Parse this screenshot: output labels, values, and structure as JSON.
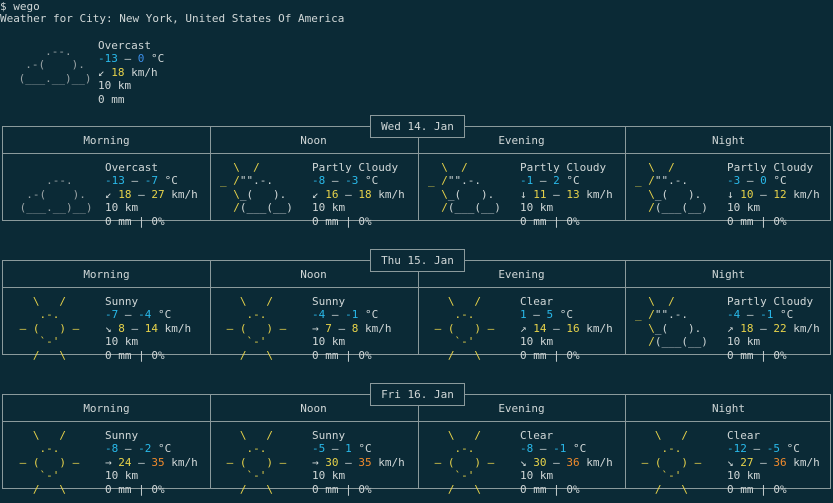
{
  "terminal": {
    "prompt": "$ wego",
    "header": "Weather for City: New York, United States Of America"
  },
  "current": {
    "art": [
      "     .--.    ",
      "  .-(    ).  ",
      " (___.__)__) "
    ],
    "art_color": "#9aa3a5",
    "condition": "Overcast",
    "temp_low": "-13",
    "temp_high": "0",
    "temp_unit": "°C",
    "wind_arrow": "↙",
    "wind_low": "18",
    "wind_high": "",
    "wind_unit": "km/h",
    "visibility": "10 km",
    "precip": "0 mm",
    "chance": ""
  },
  "segments": [
    "Morning",
    "Noon",
    "Evening",
    "Night"
  ],
  "days": [
    {
      "date": "Wed 14. Jan",
      "slots": [
        {
          "art_type": "cloud",
          "condition": "Overcast",
          "temp_low": "-13",
          "temp_high": "-7",
          "wind_arrow": "↙",
          "wind_low": "18",
          "wind_high": "27",
          "visibility": "10 km",
          "precip": "0 mm | 0%"
        },
        {
          "art_type": "partly",
          "condition": "Partly Cloudy",
          "temp_low": "-8",
          "temp_high": "-3",
          "wind_arrow": "↙",
          "wind_low": "16",
          "wind_high": "18",
          "visibility": "10 km",
          "precip": "0 mm | 0%"
        },
        {
          "art_type": "partly",
          "condition": "Partly Cloudy",
          "temp_low": "-1",
          "temp_high": "2",
          "wind_arrow": "↓",
          "wind_low": "11",
          "wind_high": "13",
          "visibility": "10 km",
          "precip": "0 mm | 0%"
        },
        {
          "art_type": "partly",
          "condition": "Partly Cloudy",
          "temp_low": "-3",
          "temp_high": "0",
          "wind_arrow": "↓",
          "wind_low": "10",
          "wind_high": "12",
          "visibility": "10 km",
          "precip": "0 mm | 0%"
        }
      ]
    },
    {
      "date": "Thu 15. Jan",
      "slots": [
        {
          "art_type": "sun",
          "condition": "Sunny",
          "temp_low": "-7",
          "temp_high": "-4",
          "wind_arrow": "↘",
          "wind_low": "8",
          "wind_high": "14",
          "visibility": "10 km",
          "precip": "0 mm | 0%"
        },
        {
          "art_type": "sun",
          "condition": "Sunny",
          "temp_low": "-4",
          "temp_high": "-1",
          "wind_arrow": "→",
          "wind_low": "7",
          "wind_high": "8",
          "visibility": "10 km",
          "precip": "0 mm | 0%"
        },
        {
          "art_type": "sun",
          "condition": "Clear",
          "temp_low": "1",
          "temp_high": "5",
          "wind_arrow": "↗",
          "wind_low": "14",
          "wind_high": "16",
          "visibility": "10 km",
          "precip": "0 mm | 0%"
        },
        {
          "art_type": "partly",
          "condition": "Partly Cloudy",
          "temp_low": "-4",
          "temp_high": "-1",
          "wind_arrow": "↗",
          "wind_low": "18",
          "wind_high": "22",
          "visibility": "10 km",
          "precip": "0 mm | 0%"
        }
      ]
    },
    {
      "date": "Fri 16. Jan",
      "slots": [
        {
          "art_type": "sun",
          "condition": "Sunny",
          "temp_low": "-8",
          "temp_high": "-2",
          "wind_arrow": "→",
          "wind_low": "24",
          "wind_high": "35",
          "visibility": "10 km",
          "precip": "0 mm | 0%"
        },
        {
          "art_type": "sun",
          "condition": "Sunny",
          "temp_low": "-5",
          "temp_high": "1",
          "wind_arrow": "→",
          "wind_low": "30",
          "wind_high": "35",
          "visibility": "10 km",
          "precip": "0 mm | 0%"
        },
        {
          "art_type": "sun",
          "condition": "Clear",
          "temp_low": "-8",
          "temp_high": "-1",
          "wind_arrow": "↘",
          "wind_low": "30",
          "wind_high": "36",
          "visibility": "10 km",
          "precip": "0 mm | 0%"
        },
        {
          "art_type": "sun",
          "condition": "Clear",
          "temp_low": "-12",
          "temp_high": "-5",
          "wind_arrow": "↘",
          "wind_low": "27",
          "wind_high": "36",
          "visibility": "10 km",
          "precip": "0 mm | 0%"
        }
      ]
    }
  ],
  "art": {
    "sun": [
      "   \\   /   ",
      "    .-.    ",
      " ― (   ) ― ",
      "    `-'    ",
      "   /   \\   "
    ],
    "partly": [
      "  \\  /     ",
      "_ /\"\".-.   ",
      "  \\_(   ).  ",
      "  /(___(__) ",
      "            "
    ],
    "cloud": [
      "             ",
      "     .--.    ",
      "  .-(    ).  ",
      " (___.__)__) ",
      "             "
    ]
  },
  "colors": {
    "background": "#0b2a36",
    "text": "#cfd6d6",
    "border": "#8b9a9c",
    "sun": "#e6d24a",
    "cloud": "#9aa3a5",
    "temp": "#29b8e8",
    "wind_low": "#e6d24a",
    "wind_high": "#f08a2c"
  }
}
